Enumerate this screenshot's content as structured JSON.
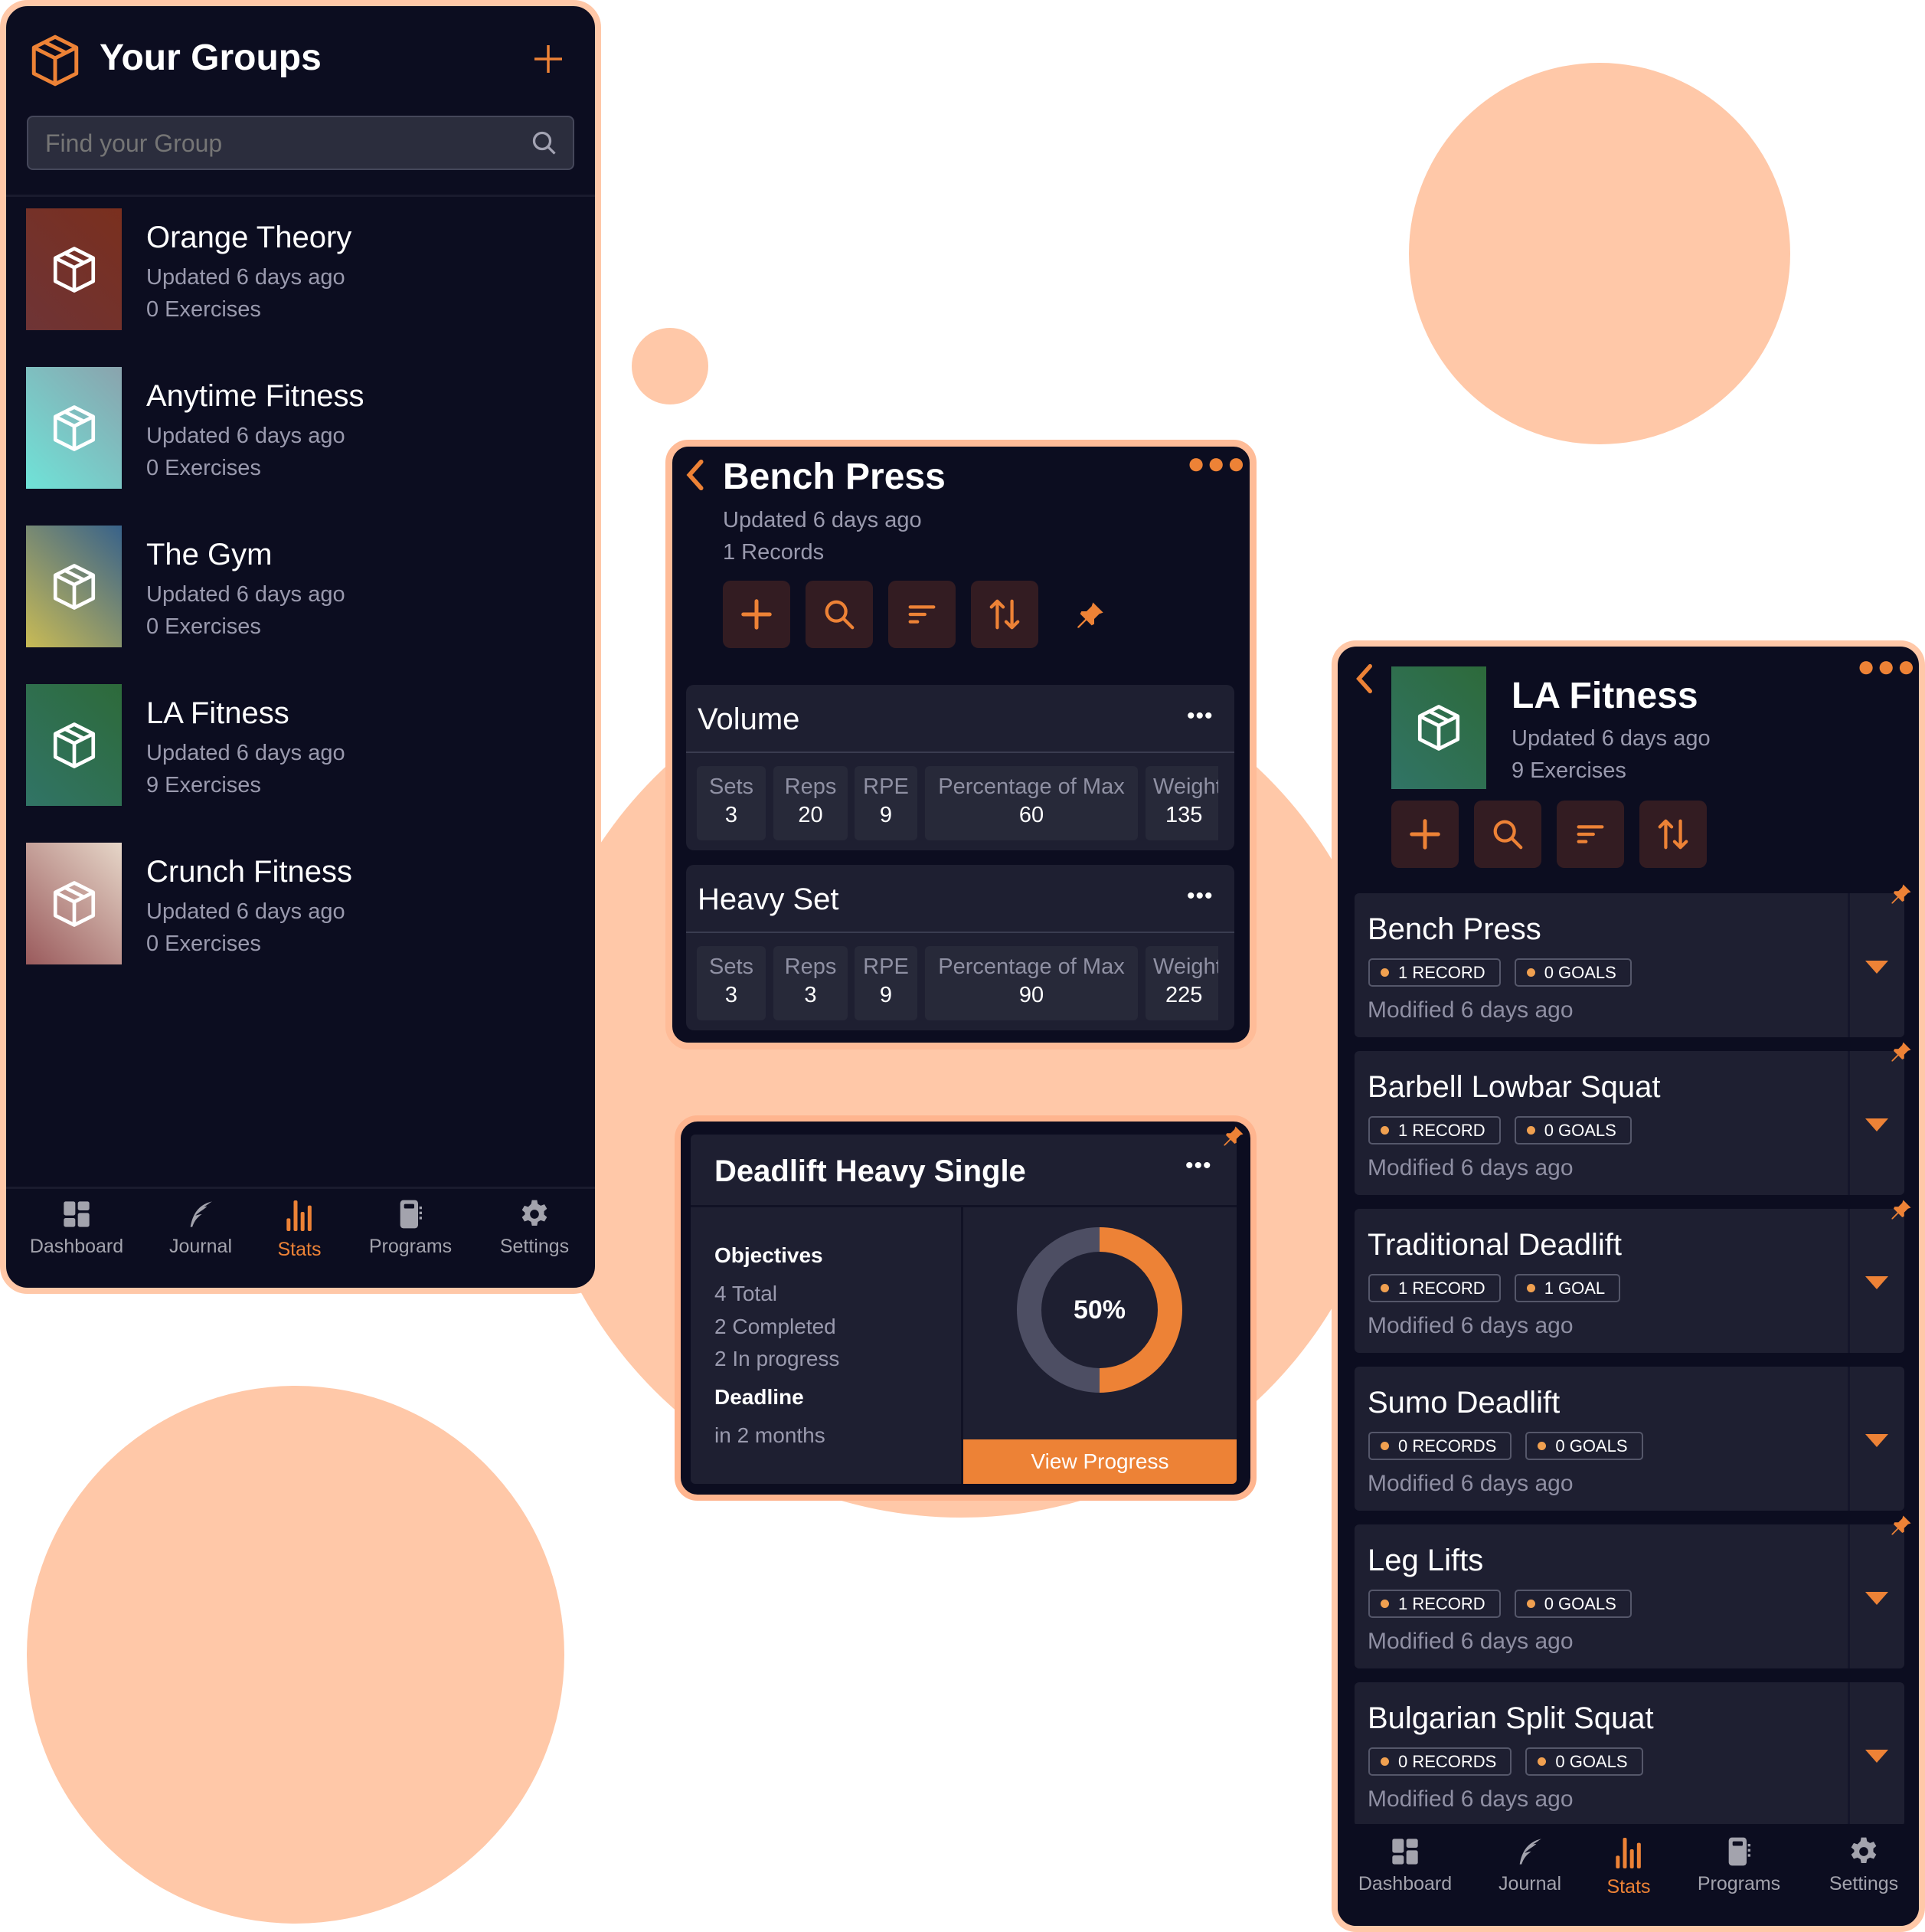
{
  "colors": {
    "accent": "#ed8236",
    "background_shape": "#ffc8a8",
    "panel": "#0c0d20",
    "card": "#1e1f31",
    "donut_track": "#4d4e63"
  },
  "groups_panel": {
    "title": "Your Groups",
    "add_icon": "plus-icon",
    "search": {
      "placeholder": "Find your Group",
      "value": ""
    },
    "groups": [
      {
        "name": "Orange Theory",
        "updated": "Updated 6 days ago",
        "exercises": "0 Exercises",
        "gradient": [
          "#7a2f1e",
          "#6e3436"
        ]
      },
      {
        "name": "Anytime Fitness",
        "updated": "Updated 6 days ago",
        "exercises": "0 Exercises",
        "gradient": [
          "#8aa3ad",
          "#6fe3d8"
        ]
      },
      {
        "name": "The Gym",
        "updated": "Updated 6 days ago",
        "exercises": "0 Exercises",
        "gradient": [
          "#38628a",
          "#c9bb55"
        ]
      },
      {
        "name": "LA Fitness",
        "updated": "Updated 6 days ago",
        "exercises": "9 Exercises",
        "gradient": [
          "#2d6a3a",
          "#317466"
        ]
      },
      {
        "name": "Crunch Fitness",
        "updated": "Updated 6 days ago",
        "exercises": "0 Exercises",
        "gradient": [
          "#e6d6c8",
          "#9a5a5c"
        ]
      }
    ]
  },
  "nav": [
    {
      "label": "Dashboard",
      "icon": "dashboard-icon",
      "active": false
    },
    {
      "label": "Journal",
      "icon": "feather-icon",
      "active": false
    },
    {
      "label": "Stats",
      "icon": "bar-chart-icon",
      "active": true
    },
    {
      "label": "Programs",
      "icon": "notebook-icon",
      "active": false
    },
    {
      "label": "Settings",
      "icon": "gear-icon",
      "active": false
    }
  ],
  "bench_panel": {
    "title": "Bench Press",
    "updated": "Updated 6 days ago",
    "records": "1 Records",
    "sections": [
      {
        "title": "Volume",
        "cells": [
          {
            "label": "Sets",
            "value": "3"
          },
          {
            "label": "Reps",
            "value": "20"
          },
          {
            "label": "RPE",
            "value": "9"
          },
          {
            "label": "Percentage of Max",
            "value": "60"
          },
          {
            "label": "Weight",
            "value": "135"
          }
        ]
      },
      {
        "title": "Heavy Set",
        "cells": [
          {
            "label": "Sets",
            "value": "3"
          },
          {
            "label": "Reps",
            "value": "3"
          },
          {
            "label": "RPE",
            "value": "9"
          },
          {
            "label": "Percentage of Max",
            "value": "90"
          },
          {
            "label": "Weight",
            "value": "225"
          }
        ]
      }
    ]
  },
  "goal_card": {
    "title": "Deadlift Heavy Single",
    "objectives_label": "Objectives",
    "total": "4 Total",
    "completed": "2 Completed",
    "in_progress": "2 In progress",
    "deadline_label": "Deadline",
    "deadline": "in 2 months",
    "progress_percent": 50,
    "progress_label": "50%",
    "button": "View Progress",
    "pinned": true
  },
  "group_detail": {
    "title": "LA Fitness",
    "updated": "Updated 6 days ago",
    "exercises": "9 Exercises",
    "items": [
      {
        "name": "Bench Press",
        "records": "1 RECORD",
        "goals": "0 GOALS",
        "modified": "Modified 6 days ago",
        "pinned": true
      },
      {
        "name": "Barbell Lowbar Squat",
        "records": "1 RECORD",
        "goals": "0 GOALS",
        "modified": "Modified 6 days ago",
        "pinned": true
      },
      {
        "name": "Traditional Deadlift",
        "records": "1 RECORD",
        "goals": "1 GOAL",
        "modified": "Modified 6 days ago",
        "pinned": true
      },
      {
        "name": "Sumo Deadlift",
        "records": "0 RECORDS",
        "goals": "0 GOALS",
        "modified": "Modified 6 days ago",
        "pinned": false
      },
      {
        "name": "Leg Lifts",
        "records": "1 RECORD",
        "goals": "0 GOALS",
        "modified": "Modified 6 days ago",
        "pinned": true
      },
      {
        "name": "Bulgarian Split Squat",
        "records": "0 RECORDS",
        "goals": "0 GOALS",
        "modified": "Modified 6 days ago",
        "pinned": false
      }
    ]
  }
}
